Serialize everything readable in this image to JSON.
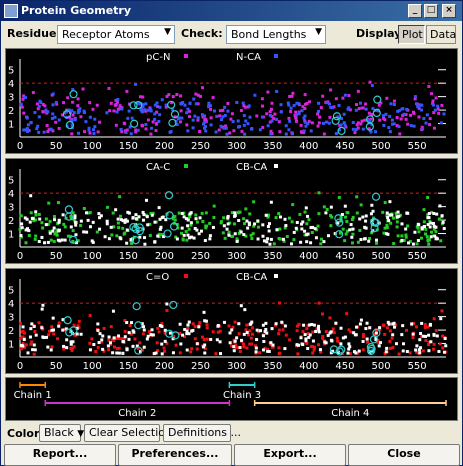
{
  "window": {
    "title": "Protein Geometry"
  },
  "toolbar": {
    "residues_label": "Residues:",
    "residues_value": "Receptor Atoms",
    "check_label": "Check:",
    "check_value": "Bond Lengths",
    "display_label": "Display:",
    "display_plot": "Plot",
    "display_data": "Data"
  },
  "colors": {
    "pcn": "#dd22dd",
    "nca": "#3355ff",
    "cac": "#22cc22",
    "cbca": "#ffffff",
    "co": "#ee1111",
    "highlight": "#33cccc",
    "threshold": "#cc2222"
  },
  "panels": [
    {
      "series": [
        {
          "name": "pC-N",
          "color": "#dd22dd"
        },
        {
          "name": "N-CA",
          "color": "#3355ff"
        }
      ],
      "y_ticks": [
        "1",
        "2",
        "3",
        "4",
        "5"
      ],
      "x_ticks": [
        "0",
        "50",
        "100",
        "150",
        "200",
        "250",
        "300",
        "350",
        "400",
        "450",
        "500",
        "550"
      ]
    },
    {
      "series": [
        {
          "name": "CA-C",
          "color": "#22cc22"
        },
        {
          "name": "CB-CA",
          "color": "#ffffff"
        }
      ],
      "y_ticks": [
        "1",
        "2",
        "3",
        "4",
        "5"
      ],
      "x_ticks": [
        "0",
        "50",
        "100",
        "150",
        "200",
        "250",
        "300",
        "350",
        "400",
        "450",
        "500",
        "550"
      ]
    },
    {
      "series": [
        {
          "name": "C=O",
          "color": "#ee1111"
        },
        {
          "name": "CB-CA",
          "color": "#ffffff"
        }
      ],
      "y_ticks": [
        "1",
        "2",
        "3",
        "4",
        "5"
      ],
      "x_ticks": [
        "0",
        "50",
        "100",
        "150",
        "200",
        "250",
        "300",
        "350",
        "400",
        "450",
        "500",
        "550"
      ]
    }
  ],
  "chart_data": [
    {
      "type": "scatter",
      "series": [
        {
          "name": "pC-N"
        },
        {
          "name": "N-CA"
        }
      ],
      "xlim": [
        0,
        590
      ],
      "ylim": [
        0,
        5.5
      ],
      "threshold": 4
    },
    {
      "type": "scatter",
      "series": [
        {
          "name": "CA-C"
        },
        {
          "name": "CB-CA"
        }
      ],
      "xlim": [
        0,
        590
      ],
      "ylim": [
        0,
        5.5
      ],
      "threshold": 4
    },
    {
      "type": "scatter",
      "series": [
        {
          "name": "C=O"
        },
        {
          "name": "CB-CA"
        }
      ],
      "xlim": [
        0,
        590
      ],
      "ylim": [
        0,
        5.5
      ],
      "threshold": 4
    }
  ],
  "chains": [
    {
      "label": "Chain 1",
      "start": 0,
      "end": 35,
      "row": 0,
      "color": "#ff8800"
    },
    {
      "label": "Chain 2",
      "start": 35,
      "end": 290,
      "row": 1,
      "color": "#cc33cc"
    },
    {
      "label": "Chain 3",
      "start": 290,
      "end": 325,
      "row": 0,
      "color": "#33cccc"
    },
    {
      "label": "Chain 4",
      "start": 325,
      "end": 590,
      "row": 1,
      "color": "#ffcc99"
    }
  ],
  "bottom": {
    "color_label": "Color:",
    "color_value": "Black",
    "clear_selection": "Clear Selection",
    "definitions": "Definitions ..."
  },
  "actions": {
    "report": "Report...",
    "preferences": "Preferences...",
    "export": "Export...",
    "close": "Close"
  }
}
